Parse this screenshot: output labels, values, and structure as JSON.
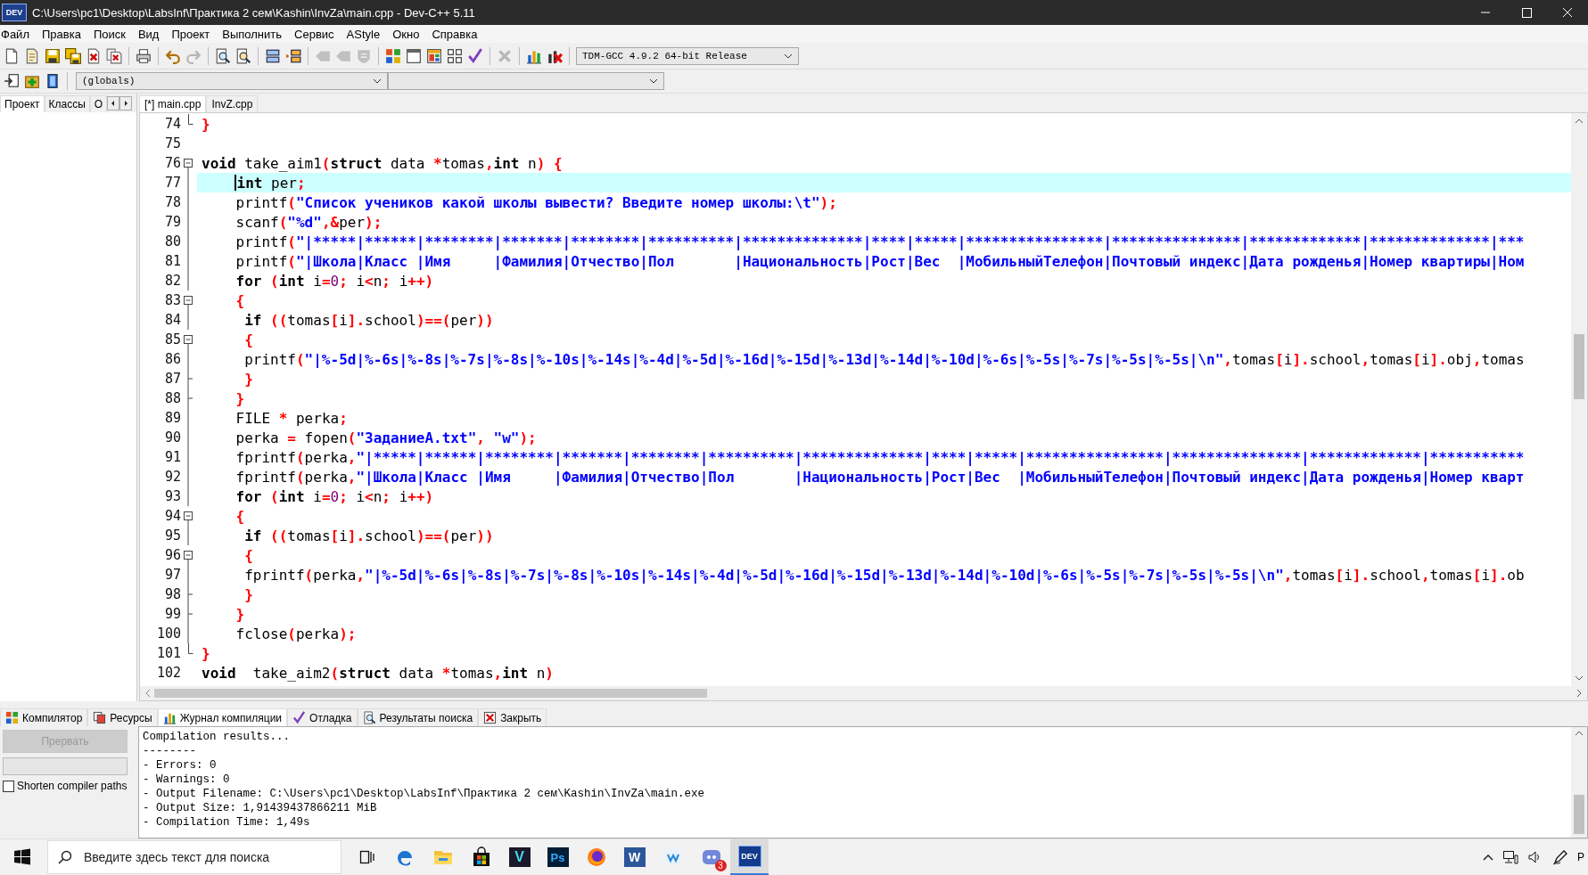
{
  "window": {
    "title": "C:\\Users\\pc1\\Desktop\\LabsInf\\Практика 2 сем\\Kashin\\InvZa\\main.cpp - Dev-C++ 5.11",
    "icon_label": "DEV"
  },
  "menu": [
    "Файл",
    "Правка",
    "Поиск",
    "Вид",
    "Проект",
    "Выполнить",
    "Сервис",
    "AStyle",
    "Окно",
    "Справка"
  ],
  "toolbar": {
    "groups": [
      [
        {
          "kind": "new",
          "disabled": false
        },
        {
          "kind": "open",
          "disabled": false
        },
        {
          "kind": "save",
          "disabled": false
        },
        {
          "kind": "saveall",
          "disabled": false
        },
        {
          "kind": "close",
          "disabled": false
        },
        {
          "kind": "closeall",
          "disabled": false
        }
      ],
      [
        {
          "kind": "print",
          "disabled": false
        }
      ],
      [
        {
          "kind": "undo",
          "disabled": false
        },
        {
          "kind": "redo",
          "disabled": true
        }
      ],
      [
        {
          "kind": "find",
          "disabled": false
        },
        {
          "kind": "replace",
          "disabled": false
        }
      ],
      [
        {
          "kind": "indent",
          "disabled": false
        },
        {
          "kind": "unindent",
          "disabled": false
        }
      ],
      [
        {
          "kind": "back",
          "disabled": true
        },
        {
          "kind": "forward",
          "disabled": true
        },
        {
          "kind": "shield",
          "disabled": true
        }
      ],
      [
        {
          "kind": "compile",
          "disabled": false
        },
        {
          "kind": "window",
          "disabled": false
        },
        {
          "kind": "run",
          "disabled": false
        },
        {
          "kind": "grid",
          "disabled": false
        },
        {
          "kind": "check",
          "disabled": false
        }
      ],
      [
        {
          "kind": "cancel",
          "disabled": true
        }
      ],
      [
        {
          "kind": "chart",
          "disabled": false
        },
        {
          "kind": "debug",
          "disabled": false
        }
      ]
    ],
    "compiler": "TDM-GCC 4.9.2 64-bit Release"
  },
  "toolbar2": {
    "scope": "(globals)"
  },
  "left_panel": {
    "tabs": [
      {
        "label": "Проект",
        "selected": true
      },
      {
        "label": "Классы",
        "selected": false
      },
      {
        "label": "О",
        "selected": false
      }
    ]
  },
  "editor_tabs": [
    {
      "label": "[*] main.cpp",
      "selected": true
    },
    {
      "label": "InvZ.cpp",
      "selected": false
    }
  ],
  "code": {
    "lines": [
      {
        "number": "74",
        "kind": "block_end",
        "current": false,
        "segments": [
          {
            "kind": "code",
            "text": "}"
          }
        ]
      },
      {
        "number": "75",
        "kind": "plain",
        "current": false
      },
      {
        "number": "76",
        "kind": "block_start",
        "current": false,
        "segments": [
          {
            "kind": "keyword",
            "text": "void"
          },
          {
            "kind": "code",
            "text": " take_aim1("
          },
          {
            "kind": "keyword",
            "text": "struct"
          },
          {
            "kind": "code",
            "text": " data *tomas,"
          },
          {
            "kind": "keyword",
            "text": "int"
          },
          {
            "kind": "code",
            "text": " n) {"
          }
        ]
      },
      {
        "number": "77",
        "kind": "guide",
        "current": true,
        "segments": [
          {
            "kind": "keyword",
            "text": "    int"
          },
          {
            "kind": "code",
            "text": " per;"
          }
        ]
      },
      {
        "number": "78",
        "kind": "guide",
        "current": false,
        "segments": [
          {
            "kind": "code",
            "text": "    printf(\"Список учеников какой школы вывести? Введите номер школы:\\t\");"
          }
        ]
      },
      {
        "number": "79",
        "kind": "guide",
        "current": false,
        "segments": [
          {
            "kind": "code",
            "text": "    scanf(\"%d\",&per);"
          }
        ]
      },
      {
        "number": "80",
        "kind": "guide",
        "current": false,
        "segments": [
          {
            "kind": "code",
            "text": "    printf(\"|*****|******|********|*******|********|**********|**************|****|*****|****************|***************|*************|**************|***"
          }
        ]
      },
      {
        "number": "81",
        "kind": "guide",
        "current": false,
        "segments": [
          {
            "kind": "code",
            "text": "    printf(\"|Школа|Класс |Имя     |Фамилия|Отчество|Пол       |Национальность|Рост|Вес  |МобильныйТелефон|Почтовый индекс|Дата рожденья|Номер квартиры|Ном"
          }
        ]
      },
      {
        "number": "82",
        "kind": "guide",
        "current": false,
        "segments": [
          {
            "kind": "keyword",
            "text": "    for"
          },
          {
            "kind": "code",
            "text": " ("
          },
          {
            "kind": "keyword",
            "text": "int"
          },
          {
            "kind": "code",
            "text": " i=0; i<n; i++)"
          }
        ]
      },
      {
        "number": "83",
        "kind": "block_start",
        "current": false,
        "segments": [
          {
            "kind": "code",
            "text": "    {"
          }
        ]
      },
      {
        "number": "84",
        "kind": "guide",
        "current": false,
        "segments": [
          {
            "kind": "keyword",
            "text": "     if"
          },
          {
            "kind": "code",
            "text": " ((tomas[i].school)==(per))"
          }
        ]
      },
      {
        "number": "85",
        "kind": "block_start",
        "current": false,
        "segments": [
          {
            "kind": "code",
            "text": "     {"
          }
        ]
      },
      {
        "number": "86",
        "kind": "guide",
        "current": false,
        "segments": [
          {
            "kind": "code",
            "text": "     printf(\"|%-5d|%-6s|%-8s|%-7s|%-8s|%-10s|%-14s|%-4d|%-5d|%-16d|%-15d|%-13d|%-14d|%-10d|%-6s|%-5s|%-7s|%-5s|%-5s|\\n\",tomas[i].school,tomas[i].obj,tomas"
          }
        ]
      },
      {
        "number": "87",
        "kind": "guide_tick",
        "current": false,
        "segments": [
          {
            "kind": "code",
            "text": "     }"
          }
        ]
      },
      {
        "number": "88",
        "kind": "guide_tick",
        "current": false,
        "segments": [
          {
            "kind": "code",
            "text": "    }"
          }
        ]
      },
      {
        "number": "89",
        "kind": "guide",
        "current": false,
        "segments": [
          {
            "kind": "code",
            "text": "    FILE * perka;"
          }
        ]
      },
      {
        "number": "90",
        "kind": "guide",
        "current": false,
        "segments": [
          {
            "kind": "code",
            "text": "    perka = fopen(\"ЗаданиеА.txt\", \"w\");"
          }
        ]
      },
      {
        "number": "91",
        "kind": "guide",
        "current": false,
        "segments": [
          {
            "kind": "code",
            "text": "    fprintf(perka,\"|*****|******|********|*******|********|**********|**************|****|*****|****************|***************|*************|***********"
          }
        ]
      },
      {
        "number": "92",
        "kind": "guide",
        "current": false,
        "segments": [
          {
            "kind": "code",
            "text": "    fprintf(perka,\"|Школа|Класс |Имя     |Фамилия|Отчество|Пол       |Национальность|Рост|Вес  |МобильныйТелефон|Почтовый индекс|Дата рожденья|Номер кварт"
          }
        ]
      },
      {
        "number": "93",
        "kind": "guide",
        "current": false,
        "segments": [
          {
            "kind": "keyword",
            "text": "    for"
          },
          {
            "kind": "code",
            "text": " ("
          },
          {
            "kind": "keyword",
            "text": "int"
          },
          {
            "kind": "code",
            "text": " i=0; i<n; i++)"
          }
        ]
      },
      {
        "number": "94",
        "kind": "block_start",
        "current": false,
        "segments": [
          {
            "kind": "code",
            "text": "    {"
          }
        ]
      },
      {
        "number": "95",
        "kind": "guide",
        "current": false,
        "segments": [
          {
            "kind": "keyword",
            "text": "     if"
          },
          {
            "kind": "code",
            "text": " ((tomas[i].school)==(per))"
          }
        ]
      },
      {
        "number": "96",
        "kind": "block_start",
        "current": false,
        "segments": [
          {
            "kind": "code",
            "text": "     {"
          }
        ]
      },
      {
        "number": "97",
        "kind": "guide",
        "current": false,
        "segments": [
          {
            "kind": "code",
            "text": "     fprintf(perka,\"|%-5d|%-6s|%-8s|%-7s|%-8s|%-10s|%-14s|%-4d|%-5d|%-16d|%-15d|%-13d|%-14d|%-10d|%-6s|%-5s|%-7s|%-5s|%-5s|\\n\",tomas[i].school,tomas[i].ob"
          }
        ]
      },
      {
        "number": "98",
        "kind": "guide_tick",
        "current": false,
        "segments": [
          {
            "kind": "code",
            "text": "     }"
          }
        ]
      },
      {
        "number": "99",
        "kind": "guide_tick",
        "current": false,
        "segments": [
          {
            "kind": "code",
            "text": "    }"
          }
        ]
      },
      {
        "number": "100",
        "kind": "guide",
        "current": false,
        "segments": [
          {
            "kind": "code",
            "text": "    fclose(perka);"
          }
        ]
      },
      {
        "number": "101",
        "kind": "block_end",
        "current": false,
        "segments": [
          {
            "kind": "code",
            "text": "}"
          }
        ]
      },
      {
        "number": "102",
        "kind": "plain",
        "current": false,
        "segments": [
          {
            "kind": "keyword",
            "text": "void"
          },
          {
            "kind": "code",
            "text": "  take_aim2("
          },
          {
            "kind": "keyword",
            "text": "struct"
          },
          {
            "kind": "code",
            "text": " data *tomas,"
          },
          {
            "kind": "keyword",
            "text": "int"
          },
          {
            "kind": "code",
            "text": " n)"
          }
        ]
      }
    ]
  },
  "bottom_tabs": [
    {
      "label": "Компилятор",
      "selected": false
    },
    {
      "label": "Ресурсы",
      "selected": false
    },
    {
      "label": "Журнал компиляции",
      "selected": true
    },
    {
      "label": "Отладка",
      "selected": false
    },
    {
      "label": "Результаты поиска",
      "selected": false
    },
    {
      "label": "Закрыть",
      "selected": false
    }
  ],
  "abort_button": {
    "label": "Прервать",
    "disabled": true
  },
  "progress": {
    "level": 0
  },
  "shorten_paths": {
    "label": "Shorten compiler paths",
    "checked": false
  },
  "log": [
    "Compilation results...",
    "--------",
    "- Errors: 0",
    "- Warnings: 0",
    "- Output Filename: C:\\Users\\pc1\\Desktop\\LabsInf\\Практика 2 сем\\Kashin\\InvZa\\main.exe",
    "- Output Size: 1,91439437866211 MiB",
    "- Compilation Time: 1,49s"
  ],
  "taskbar": {
    "search_placeholder": "Введите здесь текст для поиска",
    "apps": [
      {
        "kind": "taskview",
        "selected": false
      },
      {
        "kind": "edge",
        "selected": false
      },
      {
        "kind": "folder",
        "selected": false
      },
      {
        "kind": "store",
        "selected": false
      },
      {
        "kind": "vegas",
        "label": "V",
        "selected": false
      },
      {
        "kind": "photoshop",
        "label": "Ps",
        "selected": false
      },
      {
        "kind": "firefox",
        "selected": false
      },
      {
        "kind": "word",
        "label": "W",
        "selected": false
      },
      {
        "kind": "wunderlist",
        "selected": false
      },
      {
        "kind": "discord",
        "badge": "3",
        "selected": false
      },
      {
        "kind": "devcpp",
        "label": "DEV",
        "selected": true
      }
    ],
    "language": "Р"
  }
}
